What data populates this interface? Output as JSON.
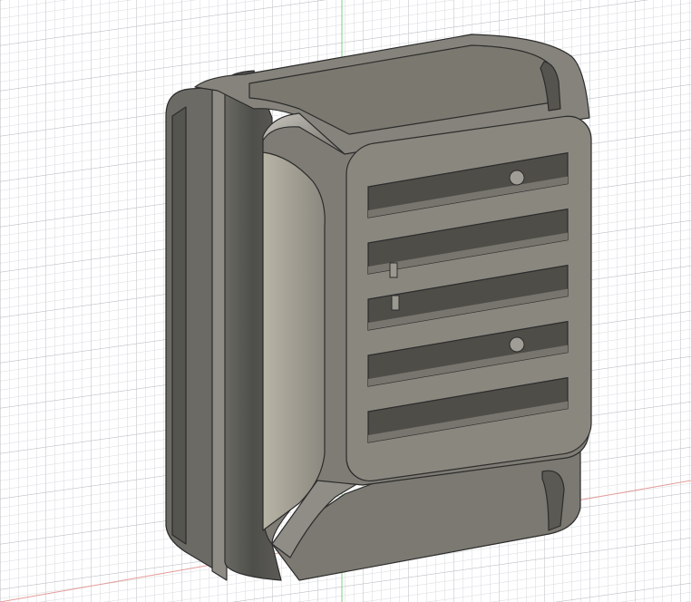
{
  "viewport": {
    "background": "#ffffff",
    "grid_minor_color": "#d6d9dc",
    "grid_major_color": "#b9bec3",
    "axis_y_color": "#7fcf7f",
    "axis_x_color": "#e59a9a"
  },
  "model": {
    "body_color": "#7d7b73",
    "body_dark": "#4f4f4b",
    "body_light": "#9a988f",
    "bezel_color": "#8a877f",
    "edge_color": "#2c2c2c",
    "vent_slot_count": 5
  }
}
